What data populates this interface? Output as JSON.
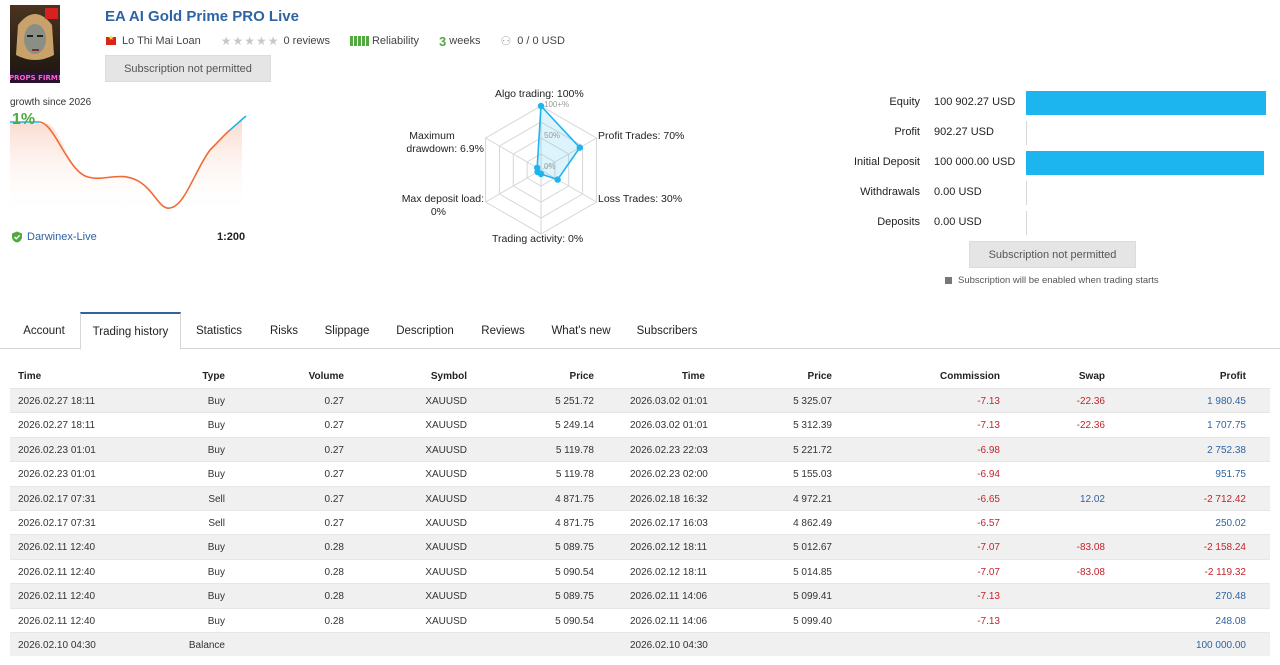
{
  "header": {
    "title": "EA AI Gold Prime PRO Live",
    "author": "Lo Thi Mai Loan",
    "reviews": "0 reviews",
    "reliability_label": "Reliability",
    "weeks_value": "3",
    "weeks_label": "weeks",
    "subscribers_funds": "0 / 0 USD",
    "subscribe_button": "Subscription not permitted",
    "avatar_text": "PROPS FIRM!"
  },
  "growth": {
    "label": "growth since 2026",
    "value": "1%",
    "broker": "Darwinex-Live",
    "leverage": "1:200"
  },
  "radar": {
    "algo_trading": "Algo trading: 100%",
    "profit_trades": "Profit Trades: 70%",
    "loss_trades": "Loss Trades: 30%",
    "trading_activity": "Trading activity: 0%",
    "max_deposit_load": "Max deposit load:",
    "max_deposit_load_val": "0%",
    "max_drawdown": "Maximum",
    "max_drawdown_2": "drawdown: 6.9%",
    "scale_100": "100+%",
    "scale_50": "50%",
    "scale_0": "0%",
    "levels": {
      "algo": 1.0,
      "profit": 0.7,
      "loss": 0.3,
      "activity": 0.0,
      "deposit": 0.0,
      "drawdown": 0.069
    }
  },
  "stats": [
    {
      "label": "Equity",
      "value": "100 902.27 USD",
      "fill": 1.0
    },
    {
      "label": "Profit",
      "value": "902.27 USD",
      "fill": 0.0
    },
    {
      "label": "Initial Deposit",
      "value": "100 000.00 USD",
      "fill": 0.99
    },
    {
      "label": "Withdrawals",
      "value": "0.00 USD",
      "fill": 0.0
    },
    {
      "label": "Deposits",
      "value": "0.00 USD",
      "fill": 0.0
    }
  ],
  "right_panel": {
    "subscribe_button": "Subscription not permitted",
    "note": "Subscription will be enabled when trading starts"
  },
  "tabs": [
    "Account",
    "Trading history",
    "Statistics",
    "Risks",
    "Slippage",
    "Description",
    "Reviews",
    "What's new",
    "Subscribers"
  ],
  "table": {
    "headers": [
      "Time",
      "Type",
      "Volume",
      "Symbol",
      "Price",
      "Time",
      "Price",
      "Commission",
      "Swap",
      "Profit"
    ],
    "rows": [
      [
        "2026.02.27 18:11",
        "Buy",
        "0.27",
        "XAUUSD",
        "5 251.72",
        "2026.03.02 01:01",
        "5 325.07",
        "-7.13",
        "-22.36",
        "1 980.45"
      ],
      [
        "2026.02.27 18:11",
        "Buy",
        "0.27",
        "XAUUSD",
        "5 249.14",
        "2026.03.02 01:01",
        "5 312.39",
        "-7.13",
        "-22.36",
        "1 707.75"
      ],
      [
        "2026.02.23 01:01",
        "Buy",
        "0.27",
        "XAUUSD",
        "5 119.78",
        "2026.02.23 22:03",
        "5 221.72",
        "-6.98",
        "",
        "2 752.38"
      ],
      [
        "2026.02.23 01:01",
        "Buy",
        "0.27",
        "XAUUSD",
        "5 119.78",
        "2026.02.23 02:00",
        "5 155.03",
        "-6.94",
        "",
        "951.75"
      ],
      [
        "2026.02.17 07:31",
        "Sell",
        "0.27",
        "XAUUSD",
        "4 871.75",
        "2026.02.18 16:32",
        "4 972.21",
        "-6.65",
        "12.02",
        "-2 712.42"
      ],
      [
        "2026.02.17 07:31",
        "Sell",
        "0.27",
        "XAUUSD",
        "4 871.75",
        "2026.02.17 16:03",
        "4 862.49",
        "-6.57",
        "",
        "250.02"
      ],
      [
        "2026.02.11 12:40",
        "Buy",
        "0.28",
        "XAUUSD",
        "5 089.75",
        "2026.02.12 18:11",
        "5 012.67",
        "-7.07",
        "-83.08",
        "-2 158.24"
      ],
      [
        "2026.02.11 12:40",
        "Buy",
        "0.28",
        "XAUUSD",
        "5 090.54",
        "2026.02.12 18:11",
        "5 014.85",
        "-7.07",
        "-83.08",
        "-2 119.32"
      ],
      [
        "2026.02.11 12:40",
        "Buy",
        "0.28",
        "XAUUSD",
        "5 089.75",
        "2026.02.11 14:06",
        "5 099.41",
        "-7.13",
        "",
        "270.48"
      ],
      [
        "2026.02.11 12:40",
        "Buy",
        "0.28",
        "XAUUSD",
        "5 090.54",
        "2026.02.11 14:06",
        "5 099.40",
        "-7.13",
        "",
        "248.08"
      ],
      [
        "2026.02.10 04:30",
        "Balance",
        "",
        "",
        "",
        "2026.02.10 04:30",
        "",
        "",
        "",
        "100 000.00"
      ]
    ]
  },
  "colors": {
    "accent": "#2e64a3",
    "bar": "#1cb5ef",
    "positive": "#52a940",
    "negative": "#c4242c",
    "growth_line": "#f06a33"
  }
}
